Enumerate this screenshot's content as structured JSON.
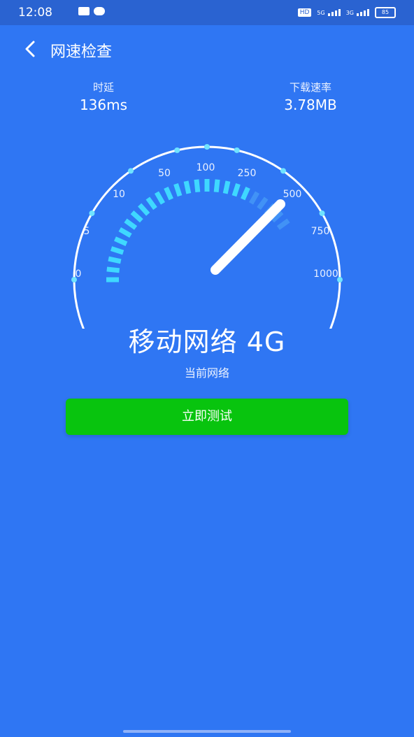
{
  "status_bar": {
    "time": "12:08",
    "battery": "85"
  },
  "header": {
    "title": "网速检查"
  },
  "metrics": {
    "latency": {
      "label": "时延",
      "value": "136ms"
    },
    "download": {
      "label": "下载速率",
      "value": "3.78MB"
    }
  },
  "gauge": {
    "scale_labels": [
      "0",
      "5",
      "10",
      "50",
      "100",
      "250",
      "500",
      "750",
      "1000"
    ]
  },
  "network": {
    "name": "移动网络 4G",
    "caption": "当前网络"
  },
  "action": {
    "test_label": "立即测试"
  },
  "colors": {
    "background": "#2F76F3",
    "button": "#08C40E",
    "arc_tick": "#3FD8FF"
  }
}
